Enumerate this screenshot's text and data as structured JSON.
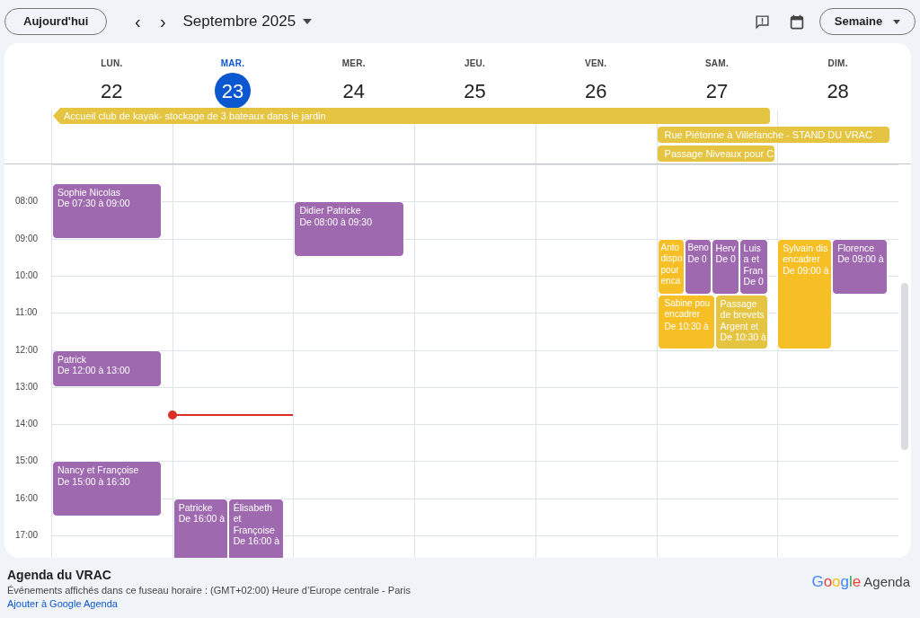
{
  "toolbar": {
    "today_button": "Aujourd'hui",
    "prev": "‹",
    "next": "›",
    "period": "Septembre 2025",
    "view": "Semaine"
  },
  "days": [
    {
      "name": "LUN.",
      "number": "22",
      "selected": false
    },
    {
      "name": "MAR.",
      "number": "23",
      "selected": true
    },
    {
      "name": "MER.",
      "number": "24",
      "selected": false
    },
    {
      "name": "JEU.",
      "number": "25",
      "selected": false
    },
    {
      "name": "VEN.",
      "number": "26",
      "selected": false
    },
    {
      "name": "SAM.",
      "number": "27",
      "selected": false
    },
    {
      "name": "DIM.",
      "number": "28",
      "selected": false
    }
  ],
  "all_day_events": [
    {
      "title": "Accueil club de kayak- stockage de 3 bateaux dans le jardin",
      "color": "#e4c441",
      "continues_before": true
    },
    {
      "title": "Rue Piétonne à Villefanche - STAND DU VRAC",
      "color": "#e4c441",
      "continues_before": false
    },
    {
      "title": "Passage Niveaux pour C",
      "color": "#e4c441",
      "continues_before": false
    }
  ],
  "hours": [
    "08:00",
    "09:00",
    "10:00",
    "11:00",
    "12:00",
    "13:00",
    "14:00",
    "15:00",
    "16:00",
    "17:00"
  ],
  "events": [
    {
      "title": "Sophie Nicolas",
      "time": "De 07:30 à 09:00",
      "color": "#9e69af"
    },
    {
      "title": "Patrick",
      "time": "De 12:00 à 13:00",
      "color": "#9e69af"
    },
    {
      "title": "Nancy et Françoise",
      "time": "De 15:00 à 16:30",
      "color": "#9e69af"
    },
    {
      "title": "Patricke",
      "time": "De 16:00 à",
      "color": "#9e69af"
    },
    {
      "title": "Élisabeth et Françoise",
      "time": "De 16:00 à",
      "color": "#9e69af"
    },
    {
      "title": "Didier Patricke",
      "time": "De 08:00 à 09:30",
      "color": "#9e69af"
    },
    {
      "title": "Anto dispo pour enca",
      "color": "#f6bf26"
    },
    {
      "title": "Beno",
      "time": "De 0",
      "color": "#9e69af"
    },
    {
      "title": "Herv",
      "time": "De 0",
      "color": "#9e69af"
    },
    {
      "title": "Luis a et Fran",
      "time": "De 0",
      "color": "#9e69af"
    },
    {
      "title": "Sabine pou encadrer",
      "time": "De 10:30 à",
      "color": "#f6bf26"
    },
    {
      "title": "Passage de brevets Argent et",
      "time": "De 10:30 à",
      "color": "#e4c441"
    },
    {
      "title": "Sylvain dis encadrer",
      "time": "De 09:00 à",
      "color": "#f6bf26"
    },
    {
      "title": "Florence",
      "time": "De 09:00 à",
      "color": "#9e69af"
    }
  ],
  "footer": {
    "calendar_name": "Agenda du VRAC",
    "timezone": "Événements affichés dans ce fuseau horaire : (GMT+02:00) Heure d’Europe centrale - Paris",
    "add_link": "Ajouter à Google Agenda",
    "logo_brand": "Google",
    "logo_product": "Agenda"
  }
}
